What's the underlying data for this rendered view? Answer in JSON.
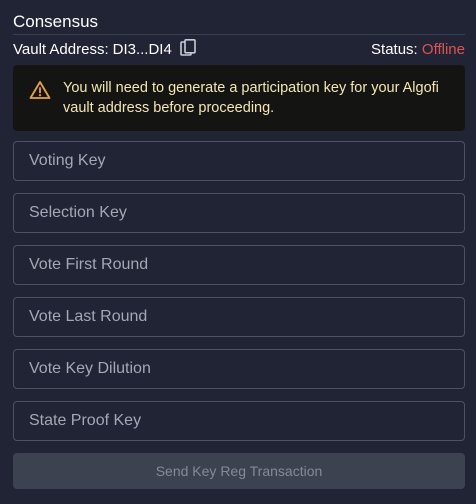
{
  "header": {
    "title": "Consensus"
  },
  "vault": {
    "address_label": "Vault Address:",
    "address_value": "DI3...DI4",
    "copy_icon": "copy-icon",
    "status_label": "Status:",
    "status_value": "Offline",
    "status_color": "#e05252"
  },
  "warning": {
    "icon": "warning-icon",
    "text": "You will need to generate a participation key for your Algofi vault address before proceeding.",
    "accent_color": "#e8a33d"
  },
  "fields": [
    {
      "placeholder": "Voting Key",
      "value": ""
    },
    {
      "placeholder": "Selection Key",
      "value": ""
    },
    {
      "placeholder": "Vote First Round",
      "value": ""
    },
    {
      "placeholder": "Vote Last Round",
      "value": ""
    },
    {
      "placeholder": "Vote Key Dilution",
      "value": ""
    },
    {
      "placeholder": "State Proof Key",
      "value": ""
    }
  ],
  "submit": {
    "label": "Send Key Reg Transaction",
    "disabled": true
  }
}
